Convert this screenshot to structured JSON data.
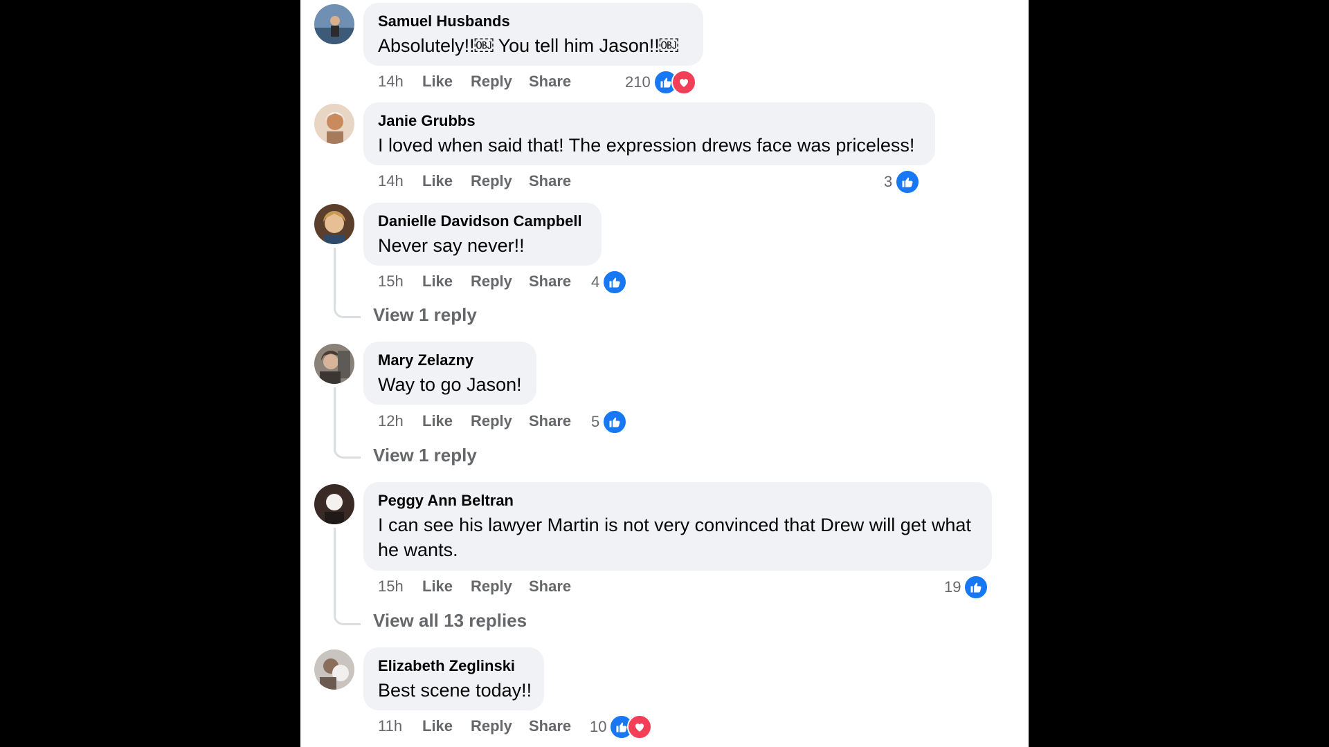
{
  "comments": [
    {
      "author": "Samuel Husbands",
      "text": "Absolutely!!￼ You tell him Jason!!￼",
      "time": "14h",
      "like": "Like",
      "reply": "Reply",
      "share": "Share",
      "reaction_count": "210",
      "reactions": [
        "like",
        "love"
      ]
    },
    {
      "author": "Janie Grubbs",
      "text": "I loved when said that! The expression drews face was priceless!",
      "time": "14h",
      "like": "Like",
      "reply": "Reply",
      "share": "Share",
      "reaction_count": "3",
      "reactions": [
        "like"
      ]
    },
    {
      "author": "Danielle Davidson Campbell",
      "text": "Never say never!!",
      "time": "15h",
      "like": "Like",
      "reply": "Reply",
      "share": "Share",
      "reaction_count": "4",
      "reactions": [
        "like"
      ],
      "view_replies": "View 1 reply"
    },
    {
      "author": "Mary Zelazny",
      "text": "Way to go Jason!",
      "time": "12h",
      "like": "Like",
      "reply": "Reply",
      "share": "Share",
      "reaction_count": "5",
      "reactions": [
        "like"
      ],
      "view_replies": "View 1 reply"
    },
    {
      "author": "Peggy Ann Beltran",
      "text": "I can see his lawyer Martin is not very convinced that Drew will get what he wants.",
      "time": "15h",
      "like": "Like",
      "reply": "Reply",
      "share": "Share",
      "reaction_count": "19",
      "reactions": [
        "like"
      ],
      "view_replies": "View all 13 replies"
    },
    {
      "author": "Elizabeth Zeglinski",
      "text": "Best scene today!!",
      "time": "11h",
      "like": "Like",
      "reply": "Reply",
      "share": "Share",
      "reaction_count": "10",
      "reactions": [
        "like",
        "love"
      ]
    }
  ],
  "colors": {
    "background": "#000000",
    "panel": "#ffffff",
    "bubble": "#f0f2f5",
    "secondary_text": "#65676b",
    "like_blue": "#1877f2",
    "love_red": "#f33e58"
  },
  "icons": {
    "like": "thumbs-up-icon",
    "love": "heart-icon"
  }
}
